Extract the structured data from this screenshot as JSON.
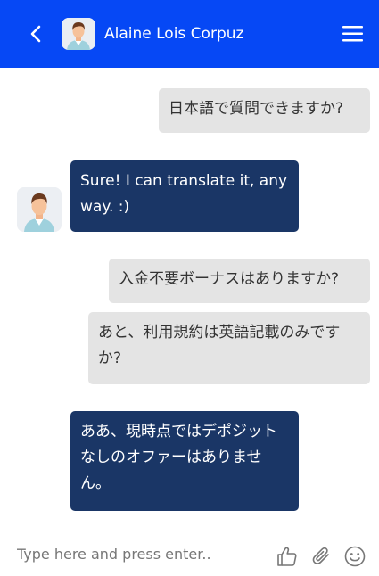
{
  "header": {
    "title": "Alaine Lois Corpuz",
    "back_icon": "chevron-left-icon",
    "menu_icon": "hamburger-menu-icon",
    "avatar": "agent-avatar"
  },
  "messages": [
    {
      "from": "user",
      "text": "日本語で質問できますか?"
    },
    {
      "from": "agent",
      "text": "Sure! I can translate it, anyway. :)"
    },
    {
      "from": "user",
      "text": "入金不要ボーナスはありますか?"
    },
    {
      "from": "user",
      "text": "あと、利用規約は英語記載のみですか?"
    },
    {
      "from": "agent",
      "text": "ああ、現時点ではデポジットなしのオファーはありません。"
    }
  ],
  "composer": {
    "placeholder": "Type here and press enter..",
    "icons": [
      "thumbs-up-icon",
      "paperclip-icon",
      "smiley-icon"
    ]
  },
  "colors": {
    "header": "#0648f5",
    "agent_bubble": "#1a3666",
    "user_bubble": "#e4e4e4"
  }
}
